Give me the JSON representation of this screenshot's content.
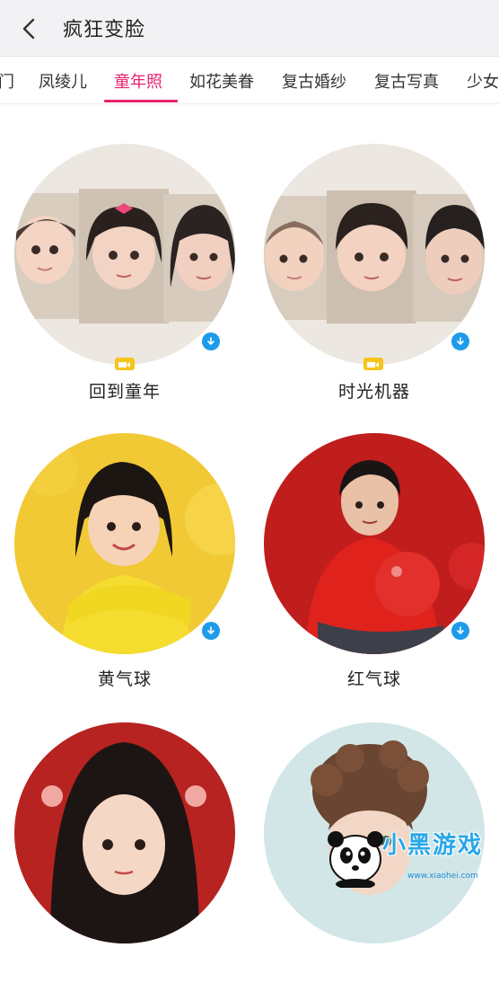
{
  "header": {
    "title": "疯狂变脸"
  },
  "tabs": [
    {
      "label": "门"
    },
    {
      "label": "凤绫儿"
    },
    {
      "label": "童年照"
    },
    {
      "label": "如花美眷"
    },
    {
      "label": "复古婚纱"
    },
    {
      "label": "复古写真"
    },
    {
      "label": "少女"
    }
  ],
  "active_tab": "童年照",
  "cards": [
    {
      "label": "回到童年",
      "has_video_badge": true,
      "downloadable": true
    },
    {
      "label": "时光机器",
      "has_video_badge": true,
      "downloadable": true
    },
    {
      "label": "黄气球",
      "has_video_badge": false,
      "downloadable": true
    },
    {
      "label": "红气球",
      "has_video_badge": false,
      "downloadable": true
    },
    {
      "label": "",
      "has_video_badge": false,
      "downloadable": false
    },
    {
      "label": "",
      "has_video_badge": false,
      "downloadable": false
    }
  ],
  "watermark": {
    "text": "小黑游戏",
    "url": "www.xiaohei.com"
  },
  "colors": {
    "accent": "#e8226e",
    "download_badge": "#1e9bea",
    "video_badge": "#f6c51c"
  }
}
